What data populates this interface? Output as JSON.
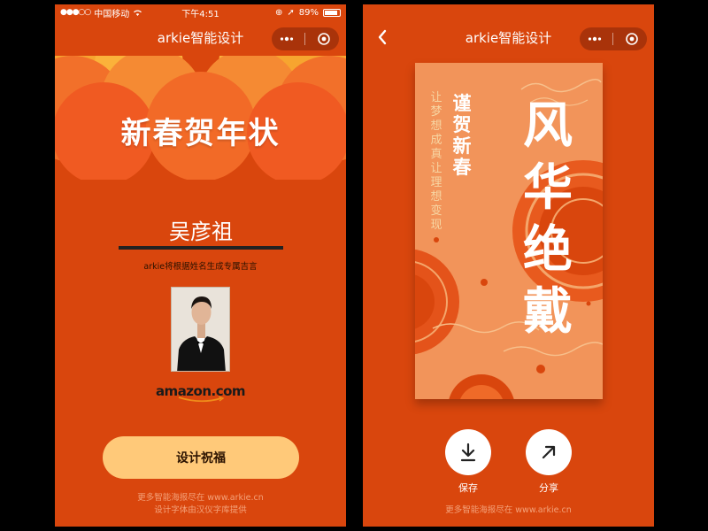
{
  "status_bar": {
    "carrier": "中国移动",
    "time": "下午4:51",
    "battery": "89%"
  },
  "left_screen": {
    "nav_title": "arkie智能设计",
    "banner_title": "新春贺年状",
    "name_value": "吴彦祖",
    "hint": "arkie将根据姓名生成专属吉言",
    "photo_logo": "amazon.com",
    "design_button": "设计祝福",
    "footer_line1": "更多智能海报尽在 www.arkie.cn",
    "footer_line2": "设计字体由汉仪字库提供"
  },
  "right_screen": {
    "nav_title": "arkie智能设计",
    "poster_big_text": "风华绝戴",
    "poster_mid_text": "谨贺新春",
    "poster_small_text": "让梦想成真让理想变现",
    "save_label": "保存",
    "share_label": "分享",
    "footer": "更多智能海报尽在 www.arkie.cn"
  },
  "colors": {
    "background": "#d9460d",
    "capsule": "#a9330a",
    "button": "#ffc979",
    "poster": "#f2945a"
  },
  "icons": {
    "more": "more-dots-icon",
    "close": "target-close-icon",
    "back": "chevron-left-icon",
    "save": "download-icon",
    "share": "share-arrow-icon"
  }
}
